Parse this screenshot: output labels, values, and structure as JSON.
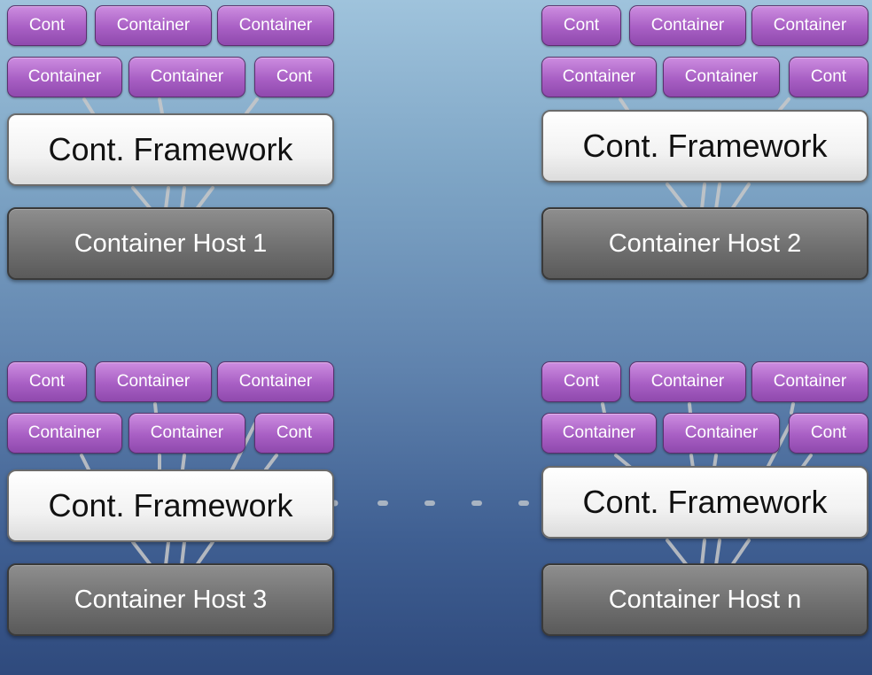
{
  "clusters": [
    {
      "containers_row1": [
        "Cont",
        "Container",
        "Container"
      ],
      "containers_row2": [
        "Container",
        "Container",
        "Cont"
      ],
      "framework": "Cont. Framework",
      "host": "Container Host 1"
    },
    {
      "containers_row1": [
        "Cont",
        "Container",
        "Container"
      ],
      "containers_row2": [
        "Container",
        "Container",
        "Cont"
      ],
      "framework": "Cont. Framework",
      "host": "Container Host 2"
    },
    {
      "containers_row1": [
        "Cont",
        "Container",
        "Container"
      ],
      "containers_row2": [
        "Container",
        "Container",
        "Cont"
      ],
      "framework": "Cont. Framework",
      "host": "Container Host 3"
    },
    {
      "containers_row1": [
        "Cont",
        "Container",
        "Container"
      ],
      "containers_row2": [
        "Container",
        "Container",
        "Cont"
      ],
      "framework": "Cont. Framework",
      "host": "Container Host n"
    }
  ],
  "colors": {
    "container_purple": "#a85fc4",
    "framework_white": "#f2f2f2",
    "host_gray": "#707070",
    "connector_gray": "#c9c9c9"
  }
}
